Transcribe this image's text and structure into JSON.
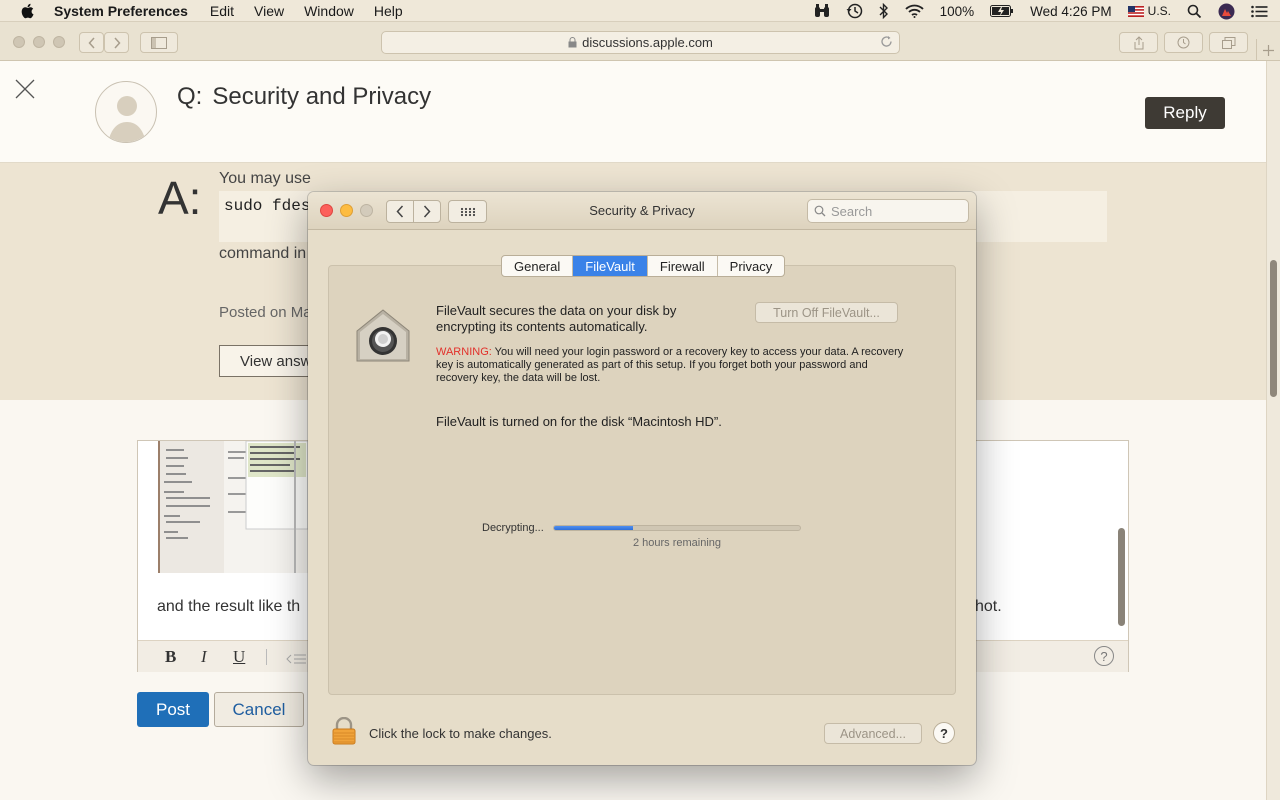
{
  "menubar": {
    "app_name": "System Preferences",
    "items": [
      "Edit",
      "View",
      "Window",
      "Help"
    ],
    "battery": "100%",
    "clock": "Wed 4:26 PM",
    "input_source": "U.S."
  },
  "browser": {
    "url": "discussions.apple.com"
  },
  "page": {
    "question_prefix": "Q:",
    "question_title": "Security and Privacy",
    "reply_label": "Reply",
    "answer_prefix": "A:",
    "answer_line1": "You may use",
    "code_snippet": "sudo fdes",
    "answer_line2": "command in",
    "posted_on": "Posted on Ma",
    "view_answer_label": "View answ",
    "editor_text_left": "and the result like th",
    "editor_text_right": "hot.",
    "post_label": "Post",
    "cancel_label": "Cancel",
    "format_bold": "B",
    "format_italic": "I",
    "format_underline": "U",
    "help_glyph": "?"
  },
  "prefs": {
    "title": "Security & Privacy",
    "search_placeholder": "Search",
    "tabs": [
      "General",
      "FileVault",
      "Firewall",
      "Privacy"
    ],
    "active_tab": "FileVault",
    "description": "FileVault secures the data on your disk by encrypting its contents automatically.",
    "turn_off_label": "Turn Off FileVault...",
    "warning_label": "WARNING:",
    "warning_text": "You will need your login password or a recovery key to access your data. A recovery key is automatically generated as part of this setup. If you forget both your password and recovery key, the data will be lost.",
    "status_text": "FileVault is turned on for the disk “Macintosh HD”.",
    "progress_label": "Decrypting...",
    "progress_fraction": 0.32,
    "remaining_text": "2 hours remaining",
    "lock_text": "Click the lock to make changes.",
    "advanced_label": "Advanced...",
    "help_glyph": "?"
  },
  "colors": {
    "accent": "#3a82e8",
    "warning": "#e2312b",
    "post_button": "#1f6fb8"
  }
}
